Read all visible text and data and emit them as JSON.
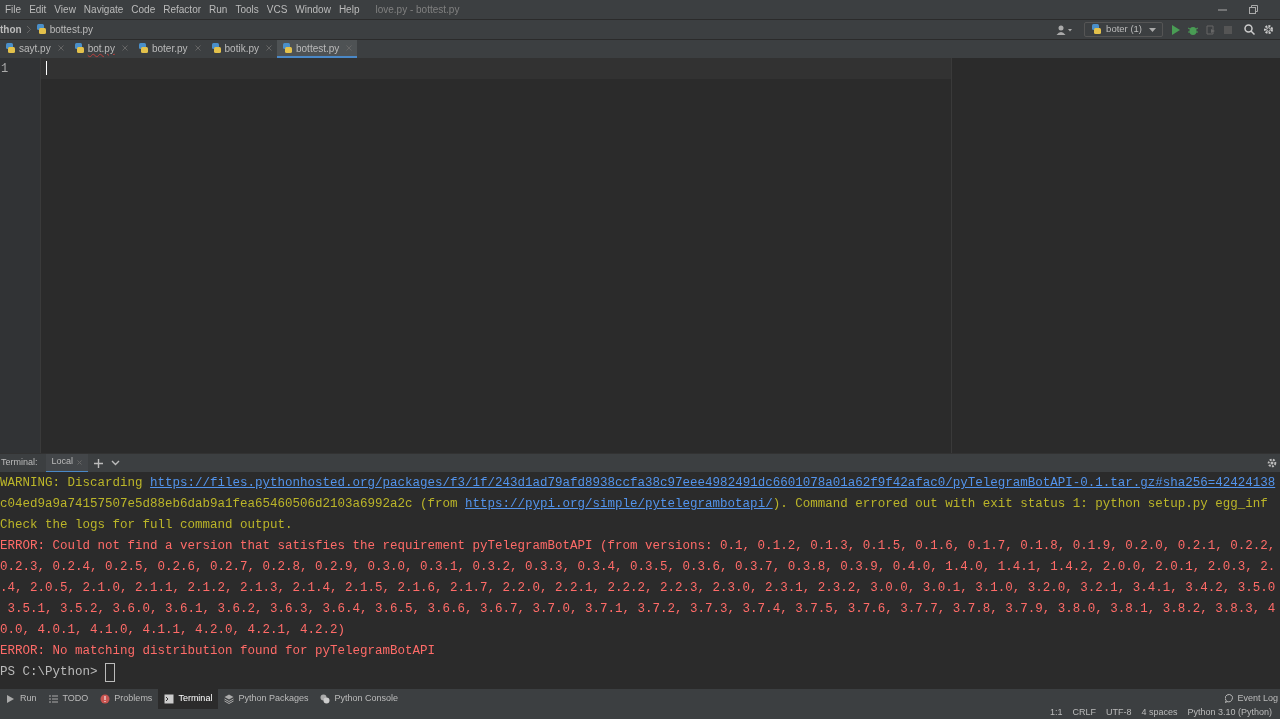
{
  "menu": {
    "items": [
      "File",
      "Edit",
      "View",
      "Navigate",
      "Code",
      "Refactor",
      "Run",
      "Tools",
      "VCS",
      "Window",
      "Help"
    ],
    "title": "love.py - bottest.py"
  },
  "breadcrumb": [
    "thon",
    "bottest.py"
  ],
  "toolbar": {
    "run_config": "boter (1)"
  },
  "tabs": [
    {
      "label": "sayt.py",
      "selected": false,
      "error": false
    },
    {
      "label": "bot.py",
      "selected": false,
      "error": true
    },
    {
      "label": "boter.py",
      "selected": false,
      "error": false
    },
    {
      "label": "botik.py",
      "selected": false,
      "error": false
    },
    {
      "label": "bottest.py",
      "selected": true,
      "error": false
    }
  ],
  "editor": {
    "line_numbers": [
      "1"
    ]
  },
  "terminal": {
    "title": "Terminal:",
    "tabs": [
      {
        "label": "Local",
        "selected": true
      }
    ],
    "lines": [
      [
        {
          "kind": "warning",
          "text": "WARNING: Discarding "
        },
        {
          "kind": "link",
          "text": "https://files.pythonhosted.org/packages/f3/1f/243d1ad79afd8938ccfa38c97eee4982491dc6601078a01a62f9f42afac0/pyTelegramBotAPI-0.1.tar.gz#sha256=42424138"
        }
      ],
      [
        {
          "kind": "warning",
          "text": "c04ed9a9a74157507e5d88eb6dab9a1fea65460506d2103a6992a2c (from "
        },
        {
          "kind": "link",
          "text": "https://pypi.org/simple/pytelegrambotapi/"
        },
        {
          "kind": "warning",
          "text": "). Command errored out with exit status 1: python setup.py egg_inf"
        }
      ],
      [
        {
          "kind": "warning",
          "text": "Check the logs for full command output."
        }
      ],
      [
        {
          "kind": "error",
          "text": "ERROR: Could not find a version that satisfies the requirement pyTelegramBotAPI (from versions: 0.1, 0.1.2, 0.1.3, 0.1.5, 0.1.6, 0.1.7, 0.1.8, 0.1.9, 0.2.0, 0.2.1, 0.2.2,"
        }
      ],
      [
        {
          "kind": "error",
          "text": "0.2.3, 0.2.4, 0.2.5, 0.2.6, 0.2.7, 0.2.8, 0.2.9, 0.3.0, 0.3.1, 0.3.2, 0.3.3, 0.3.4, 0.3.5, 0.3.6, 0.3.7, 0.3.8, 0.3.9, 0.4.0, 1.4.0, 1.4.1, 1.4.2, 2.0.0, 2.0.1, 2.0.3, 2."
        }
      ],
      [
        {
          "kind": "error",
          "text": ".4, 2.0.5, 2.1.0, 2.1.1, 2.1.2, 2.1.3, 2.1.4, 2.1.5, 2.1.6, 2.1.7, 2.2.0, 2.2.1, 2.2.2, 2.2.3, 2.3.0, 2.3.1, 2.3.2, 3.0.0, 3.0.1, 3.1.0, 3.2.0, 3.2.1, 3.4.1, 3.4.2, 3.5.0"
        }
      ],
      [
        {
          "kind": "error",
          "text": " 3.5.1, 3.5.2, 3.6.0, 3.6.1, 3.6.2, 3.6.3, 3.6.4, 3.6.5, 3.6.6, 3.6.7, 3.7.0, 3.7.1, 3.7.2, 3.7.3, 3.7.4, 3.7.5, 3.7.6, 3.7.7, 3.7.8, 3.7.9, 3.8.0, 3.8.1, 3.8.2, 3.8.3, 4"
        }
      ],
      [
        {
          "kind": "error",
          "text": "0.0, 4.0.1, 4.1.0, 4.1.1, 4.2.0, 4.2.1, 4.2.2)"
        }
      ],
      [
        {
          "kind": "error",
          "text": "ERROR: No matching distribution found for pyTelegramBotAPI"
        }
      ],
      [
        {
          "kind": "prompt",
          "text": "PS C:\\Python> "
        }
      ]
    ]
  },
  "tool_windows": [
    {
      "label": "Run",
      "kind": "run",
      "selected": false
    },
    {
      "label": "TODO",
      "kind": "list",
      "selected": false
    },
    {
      "label": "Problems",
      "kind": "problems",
      "selected": false
    },
    {
      "label": "Terminal",
      "kind": "terminal",
      "selected": true
    },
    {
      "label": "Python Packages",
      "kind": "packages",
      "selected": false
    },
    {
      "label": "Python Console",
      "kind": "console",
      "selected": false
    }
  ],
  "status_bar": {
    "event_log": "Event Log",
    "items": [
      "1:1",
      "CRLF",
      "UTF-8",
      "4 spaces",
      "Python 3.10 (Python)"
    ]
  }
}
